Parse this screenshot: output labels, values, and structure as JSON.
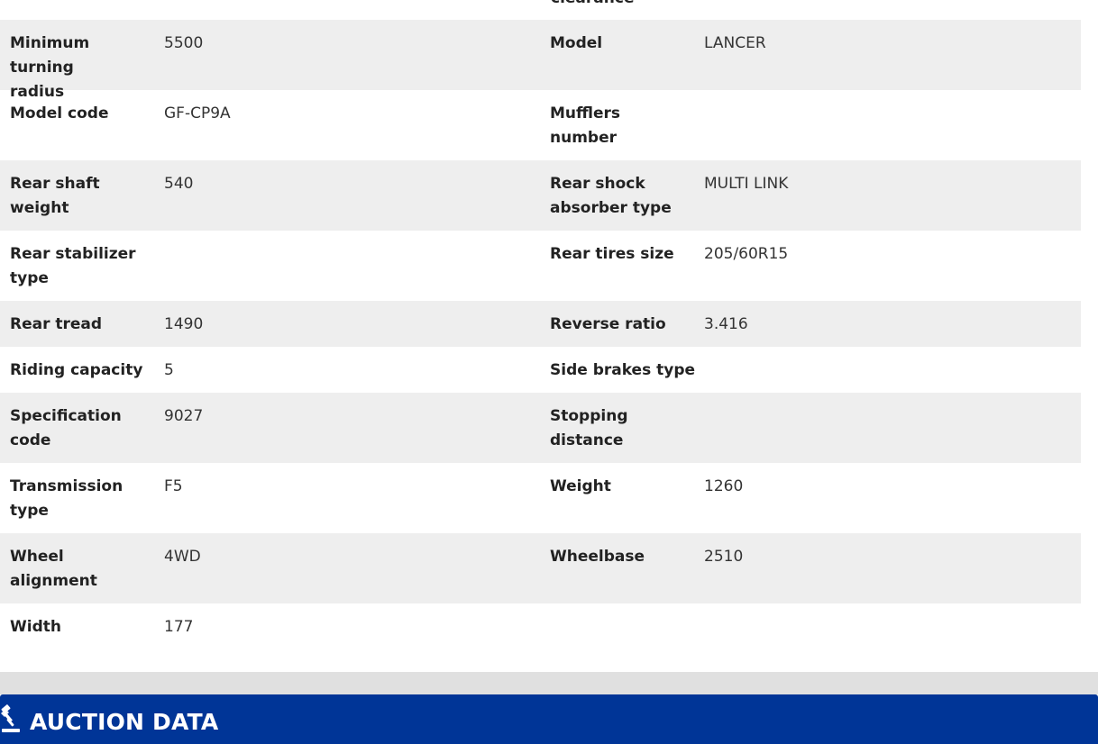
{
  "cut_off_label": "clearance",
  "specs": [
    {
      "l1": "Minimum turning radius",
      "v1": "5500",
      "l2": "Model",
      "v2": "LANCER"
    },
    {
      "l1": "Model code",
      "v1": "GF-CP9A",
      "l2": "Mufflers number",
      "v2": ""
    },
    {
      "l1": "Rear shaft weight",
      "v1": "540",
      "l2": "Rear shock absorber type",
      "v2": "MULTI LINK"
    },
    {
      "l1": "Rear stabilizer type",
      "v1": "",
      "l2": "Rear tires size",
      "v2": "205/60R15"
    },
    {
      "l1": "Rear tread",
      "v1": "1490",
      "l2": "Reverse ratio",
      "v2": "3.416"
    },
    {
      "l1": "Riding capacity",
      "v1": "5",
      "l2": "Side brakes type",
      "v2": ""
    },
    {
      "l1": "Specification code",
      "v1": "9027",
      "l2": "Stopping distance",
      "v2": ""
    },
    {
      "l1": "Transmission type",
      "v1": "F5",
      "l2": "Weight",
      "v2": "1260"
    },
    {
      "l1": "Wheel alignment",
      "v1": "4WD",
      "l2": "Wheelbase",
      "v2": "2510"
    },
    {
      "l1": "Width",
      "v1": "177",
      "l2": "",
      "v2": ""
    }
  ],
  "auction_section": {
    "title": "AUCTION DATA",
    "icon": "gavel-icon"
  },
  "colors": {
    "row_alt": "#eeeeee",
    "section_bar": "#003597",
    "band": "#e0e0e0"
  }
}
